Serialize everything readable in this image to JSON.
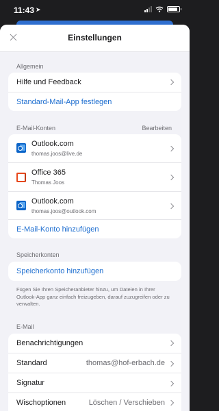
{
  "status_bar": {
    "time": "11:43",
    "location_glyph": "➤"
  },
  "header": {
    "title": "Einstellungen"
  },
  "general": {
    "label": "Allgemein",
    "items": [
      {
        "label": "Hilfe und Feedback"
      },
      {
        "label": "Standard-Mail-App festlegen"
      }
    ]
  },
  "accounts": {
    "label": "E-Mail-Konten",
    "edit_label": "Bearbeiten",
    "items": [
      {
        "name": "Outlook.com",
        "email": "thomas.joos@live.de",
        "icon": "outlook-icon"
      },
      {
        "name": "Office 365",
        "email": "Thomas Joos",
        "icon": "office365-icon"
      },
      {
        "name": "Outlook.com",
        "email": "thomas.joos@outlook.com",
        "icon": "outlook-icon"
      }
    ],
    "add_label": "E-Mail-Konto hinzufügen"
  },
  "storage": {
    "label": "Speicherkonten",
    "add_label": "Speicherkonto hinzufügen",
    "info": "Fügen Sie Ihren Speicheranbieter hinzu, um Dateien in Ihrer Outlook-App ganz einfach freizugeben, darauf zuzugreifen oder zu verwalten."
  },
  "email": {
    "label": "E-Mail",
    "items": [
      {
        "label": "Benachrichtigungen",
        "value": ""
      },
      {
        "label": "Standard",
        "value": "thomas@hof-erbach.de"
      },
      {
        "label": "Signatur",
        "value": ""
      },
      {
        "label": "Wischoptionen",
        "value": "Löschen / Verschieben"
      }
    ]
  },
  "colors": {
    "accent": "#1f6fd0",
    "background": "#f2f2f7",
    "outlook": "#0a64c8",
    "office": "#e8481c"
  }
}
